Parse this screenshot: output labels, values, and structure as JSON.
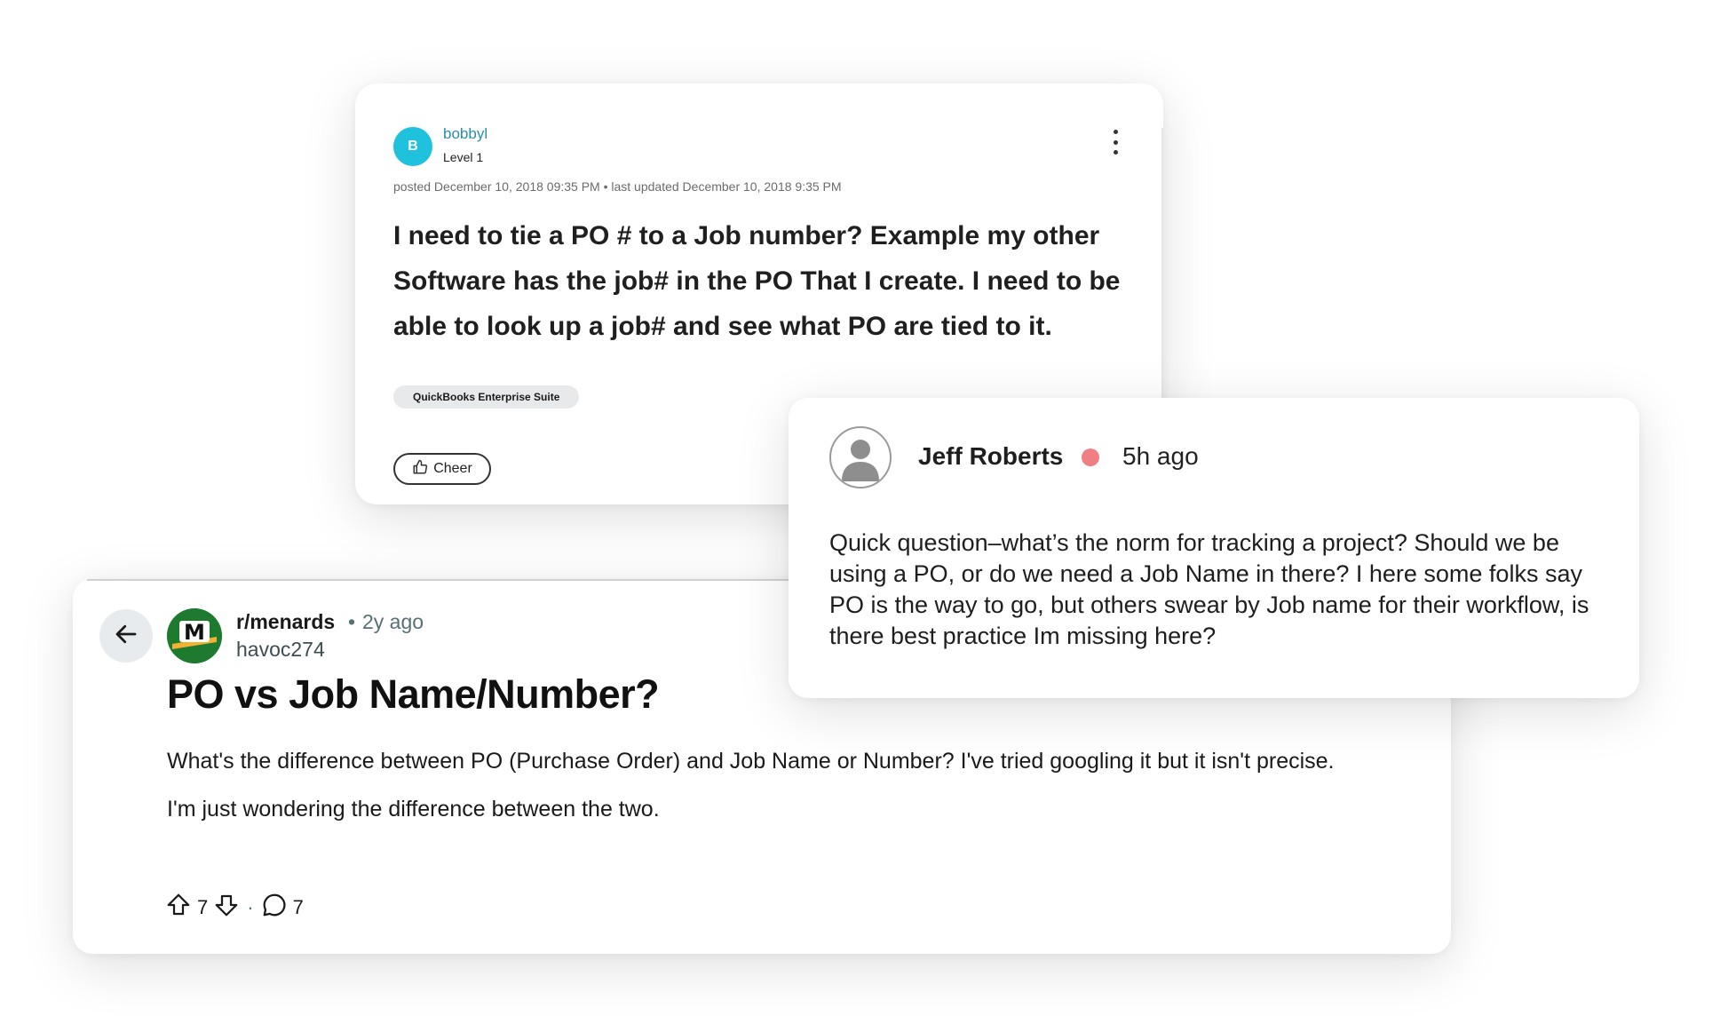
{
  "quickbooks_post": {
    "avatar_letter": "B",
    "username": "bobbyl",
    "level": "Level 1",
    "meta": "posted December 10, 2018 09:35 PM • last updated December 10, 2018 9:35 PM",
    "body": "I need to tie a PO # to a Job number? Example my other Software has the job# in the PO That I create. I need to be able to look up a job# and see what PO are tied to it.",
    "tag": "QuickBooks Enterprise Suite",
    "cheer_label": "Cheer",
    "colors": {
      "avatar": "#1fc1dd",
      "username": "#2b8ea8"
    },
    "icons": [
      "more-options-icon",
      "thumbs-up-icon"
    ]
  },
  "reddit_post": {
    "subreddit": "r/menards",
    "separator": "•",
    "time": "2y ago",
    "author": "havoc274",
    "title": "PO vs Job Name/Number?",
    "body_paragraphs": [
      "What's the difference between PO (Purchase Order) and Job Name or Number? I've tried googling it but it isn't precise.",
      "I'm just wondering the difference between the two."
    ],
    "upvotes": "7",
    "comments": "7",
    "action_separator": "·",
    "subreddit_icon_letter": "M",
    "colors": {
      "subreddit_icon_bg": "#1d7a2e"
    },
    "icons": [
      "back-arrow-icon",
      "upvote-icon",
      "downvote-icon",
      "comment-icon"
    ]
  },
  "jeff_comment": {
    "name": "Jeff Roberts",
    "time": "5h ago",
    "body": "Quick question–what’s the norm for tracking a project? Should we be using a PO, or do we need a Job Name in there? I here some folks say PO is the way to go, but others swear by Job name for their workflow, is there best practice Im missing here?",
    "colors": {
      "status_dot": "#f07f84"
    },
    "icons": [
      "default-user-avatar-icon"
    ]
  }
}
